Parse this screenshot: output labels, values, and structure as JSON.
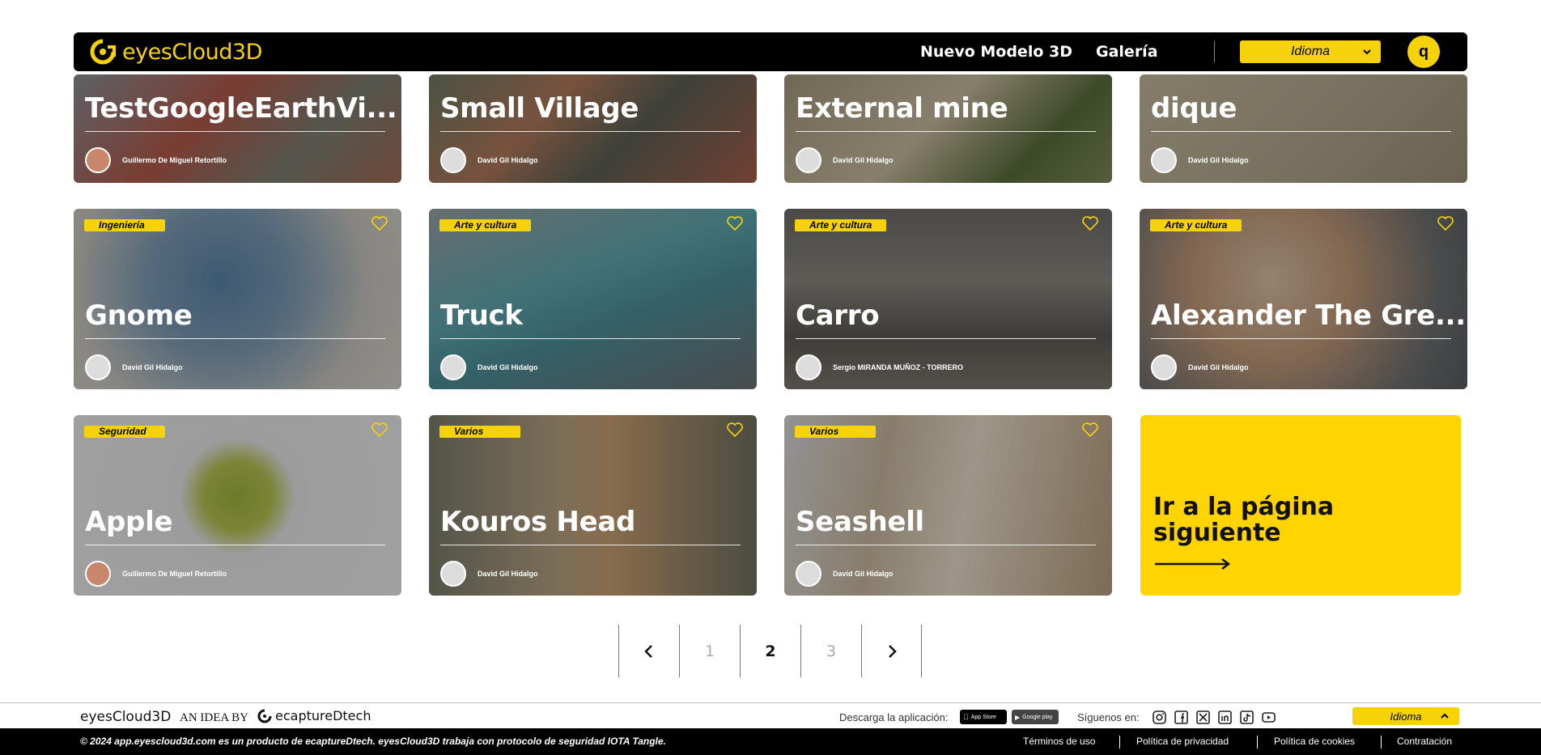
{
  "header": {
    "logo_text": "eyesCloud3D",
    "nav": [
      {
        "label": "Nuevo Modelo 3D"
      },
      {
        "label": "Galería"
      }
    ],
    "language_select": "Idioma",
    "user_initial": "q"
  },
  "cards": [
    {
      "title": "TestGoogleEarthVi...",
      "author": "Guillermo De Miguel Retortillo",
      "tag": ""
    },
    {
      "title": "Small Village",
      "author": "David Gil Hidalgo",
      "tag": ""
    },
    {
      "title": "External mine",
      "author": "David Gil Hidalgo",
      "tag": ""
    },
    {
      "title": "dique",
      "author": "David Gil Hidalgo",
      "tag": ""
    },
    {
      "title": "Gnome",
      "author": "David Gil Hidalgo",
      "tag": "Ingeniería"
    },
    {
      "title": "Truck",
      "author": "David Gil Hidalgo",
      "tag": "Arte y cultura"
    },
    {
      "title": "Carro",
      "author": "Sergio MIRANDA MUÑOZ - TORRERO",
      "tag": "Arte y cultura"
    },
    {
      "title": "Alexander The Gre...",
      "author": "David Gil Hidalgo",
      "tag": "Arte y cultura"
    },
    {
      "title": "Apple",
      "author": "Guillermo De Miguel Retortillo",
      "tag": "Seguridad"
    },
    {
      "title": "Kouros Head",
      "author": "David Gil Hidalgo",
      "tag": "Varios"
    },
    {
      "title": "Seashell",
      "author": "David Gil Hidalgo",
      "tag": "Varios"
    }
  ],
  "next_page_card": {
    "text": "Ir a la página siguiente"
  },
  "pagination": {
    "pages": [
      "1",
      "2",
      "3"
    ],
    "current": "2"
  },
  "footer": {
    "brand": "eyesCloud3D",
    "idea_by": "AN IDEA BY",
    "partner": "ecaptureDtech",
    "download_label": "Descarga la aplicación:",
    "app_store": "App Store",
    "google_play": "Google play",
    "follow_label": "Síguenos en:",
    "language_select": "Idioma",
    "copyright": "© 2024 app.eyescloud3d.com es un producto de ecaptureDtech. eyesCloud3D trabaja con protocolo de seguridad IOTA Tangle.",
    "legal_links": [
      "Términos de uso",
      "Política de privacidad",
      "Política de cookies",
      "Contratación"
    ]
  },
  "colors": {
    "accent": "#f5d20a",
    "header_bg": "#000000"
  }
}
